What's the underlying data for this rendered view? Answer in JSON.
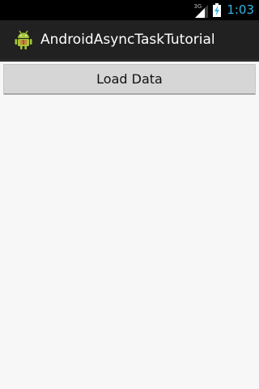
{
  "status_bar": {
    "network_type": "3G",
    "signal_icon": "signal-bars-icon",
    "battery_icon": "battery-charging-icon",
    "time": "1:03",
    "accent_color": "#33b5e5"
  },
  "action_bar": {
    "app_icon": "android-icon",
    "title": "AndroidAsyncTaskTutorial"
  },
  "main": {
    "load_button_label": "Load Data"
  }
}
